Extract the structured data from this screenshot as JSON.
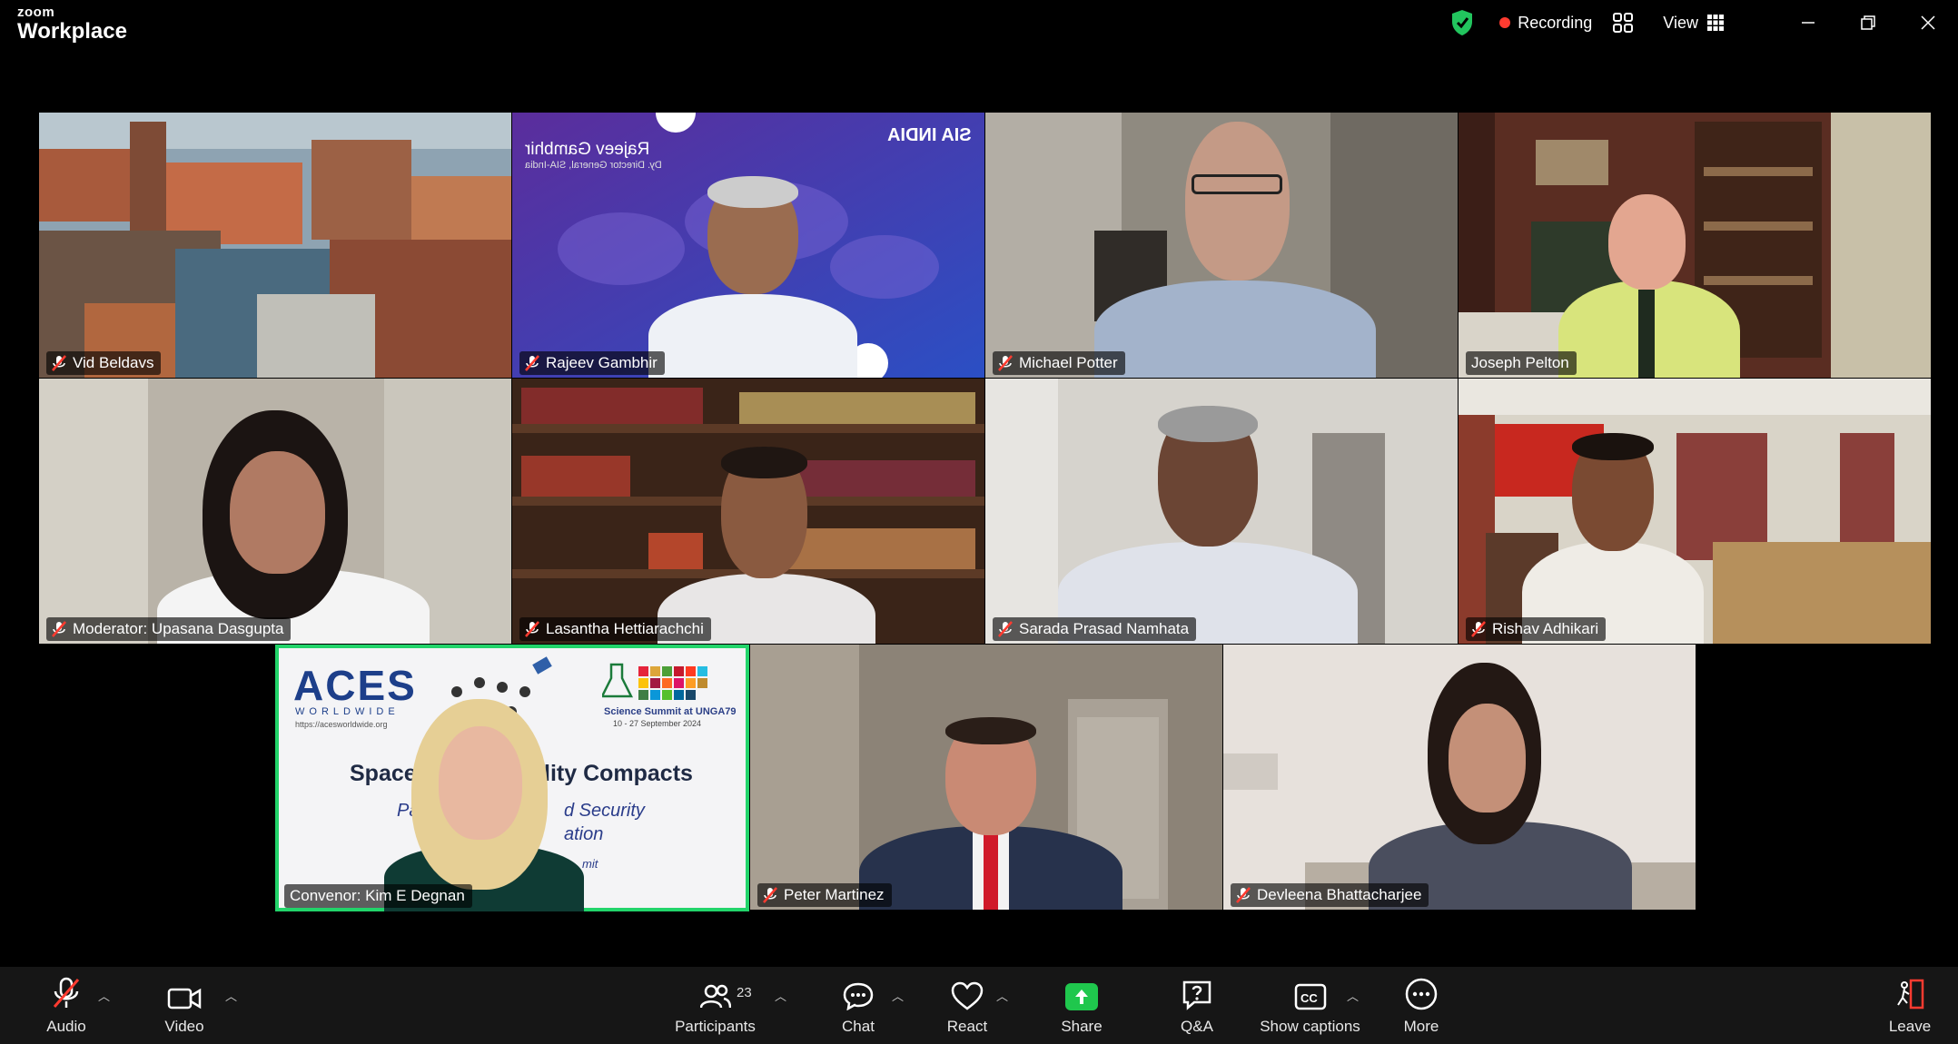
{
  "app": {
    "brand_top": "zoom",
    "brand_bottom": "Workplace"
  },
  "titlebar": {
    "recording_label": "Recording",
    "view_label": "View"
  },
  "participants": [
    {
      "name": "Vid Beldavs",
      "muted": true
    },
    {
      "name": "Rajeev Gambhir",
      "muted": true
    },
    {
      "name": "Michael Potter",
      "muted": true
    },
    {
      "name": "Joseph Pelton",
      "muted": false
    },
    {
      "name": "Moderator: Upasana Dasgupta",
      "muted": true
    },
    {
      "name": "Lasantha Hettiarachchi",
      "muted": true
    },
    {
      "name": "Sarada Prasad Namhata",
      "muted": true
    },
    {
      "name": "Rishav Adhikari",
      "muted": true
    },
    {
      "name": "Convenor: Kim E Degnan",
      "muted": false,
      "active_speaker": true
    },
    {
      "name": "Peter Martinez",
      "muted": true
    },
    {
      "name": "Devleena Bhattacharjee",
      "muted": true
    }
  ],
  "tiles_text": {
    "rajeev_banner_name": "Rajeev Gambhir",
    "rajeev_banner_title": "Dy. Director General, SIA-India",
    "sia_logo": "SIA INDIA",
    "aces_logo": "ACES",
    "aces_sub": "WORLDWIDE",
    "aces_url": "https://acesworldwide.org",
    "summit_title": "Science Summit at UNGA79",
    "summit_dates": "10 - 27 September 2024",
    "slide_title_left": "Space &",
    "slide_title_right": "lity Compacts",
    "slide_line2_left": "Part",
    "slide_line2_right": "d Security",
    "slide_line3": "ation",
    "slide_line4": "mit"
  },
  "toolbar": {
    "audio": "Audio",
    "video": "Video",
    "participants": "Participants",
    "participants_count": "23",
    "chat": "Chat",
    "react": "React",
    "share": "Share",
    "qa": "Q&A",
    "captions": "Show captions",
    "more": "More",
    "leave": "Leave"
  },
  "colors": {
    "active_speaker_border": "#22d46a",
    "share_green": "#1fc74d",
    "recording_red": "#ff3b30"
  }
}
